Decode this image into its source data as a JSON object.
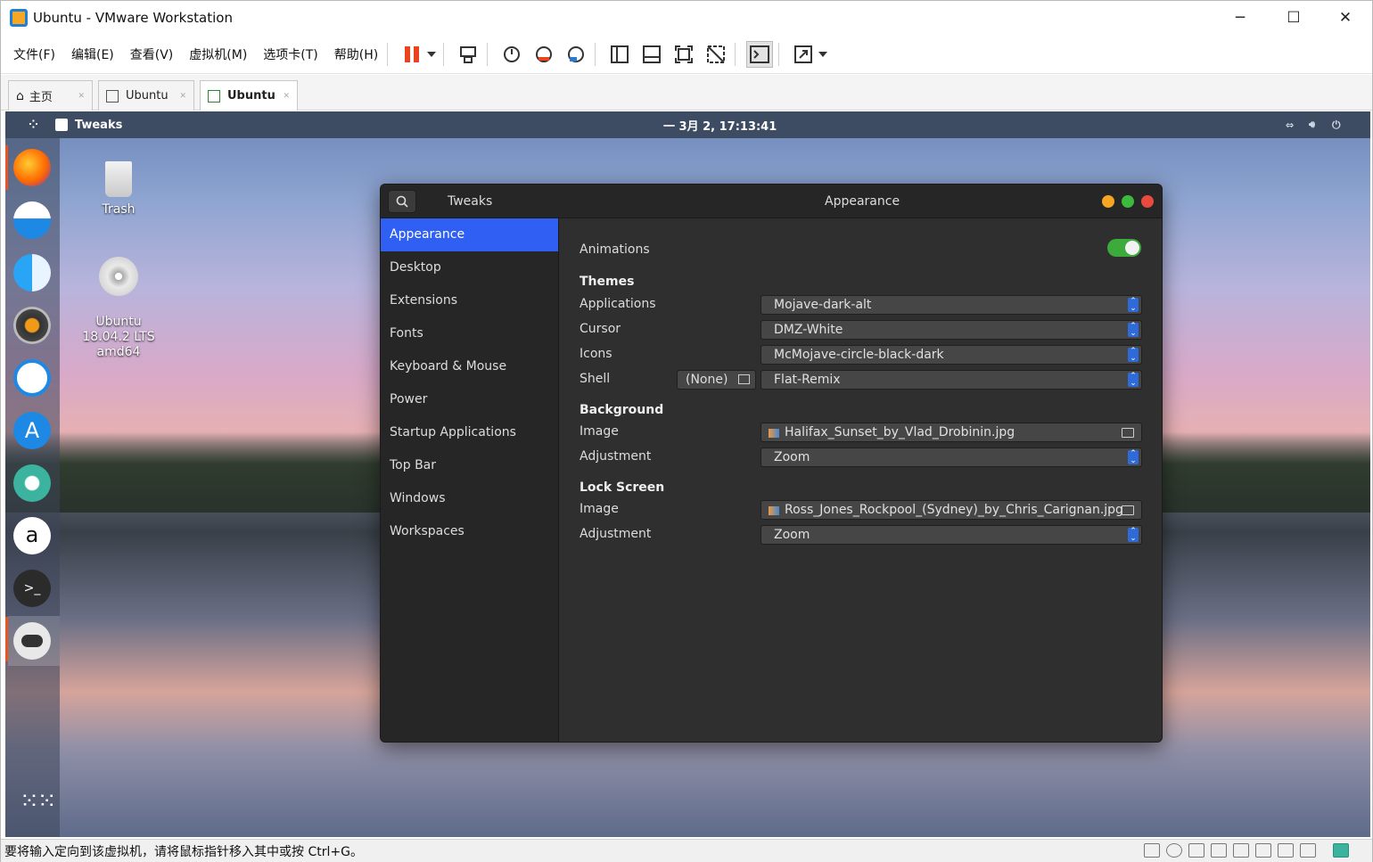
{
  "window": {
    "title": "Ubuntu - VMware Workstation",
    "controls": {
      "minimize": "─",
      "maximize": "☐",
      "close": "✕"
    }
  },
  "menu": [
    "文件(F)",
    "编辑(E)",
    "查看(V)",
    "虚拟机(M)",
    "选项卡(T)",
    "帮助(H)"
  ],
  "tabs": [
    {
      "label": "主页"
    },
    {
      "label": "Ubuntu"
    },
    {
      "label": "Ubuntu"
    }
  ],
  "guest": {
    "topbar": {
      "app": "Tweaks",
      "clock": "一 3月  2, 17:13:41"
    },
    "desktop_icons": [
      {
        "label": "Trash"
      },
      {
        "label": "Ubuntu\n18.04.2 LTS\namd64"
      }
    ]
  },
  "tweaks": {
    "app_title": "Tweaks",
    "panel_title": "Appearance",
    "sidebar": [
      "Appearance",
      "Desktop",
      "Extensions",
      "Fonts",
      "Keyboard & Mouse",
      "Power",
      "Startup Applications",
      "Top Bar",
      "Windows",
      "Workspaces"
    ],
    "selected": "Appearance",
    "animations_label": "Animations",
    "animations_on": true,
    "themes": {
      "heading": "Themes",
      "applications": {
        "label": "Applications",
        "value": "Mojave-dark-alt"
      },
      "cursor": {
        "label": "Cursor",
        "value": "DMZ-White"
      },
      "icons": {
        "label": "Icons",
        "value": "McMojave-circle-black-dark"
      },
      "shell": {
        "label": "Shell",
        "file": "(None)",
        "value": "Flat-Remix"
      }
    },
    "background": {
      "heading": "Background",
      "image_label": "Image",
      "image": "Halifax_Sunset_by_Vlad_Drobinin.jpg",
      "adj_label": "Adjustment",
      "adjustment": "Zoom"
    },
    "lockscreen": {
      "heading": "Lock Screen",
      "image_label": "Image",
      "image": "Ross_Jones_Rockpool_(Sydney)_by_Chris_Carignan.jpg",
      "adj_label": "Adjustment",
      "adjustment": "Zoom"
    }
  },
  "statusbar": {
    "text": "要将输入定向到该虚拟机，请将鼠标指针移入其中或按 Ctrl+G。"
  }
}
